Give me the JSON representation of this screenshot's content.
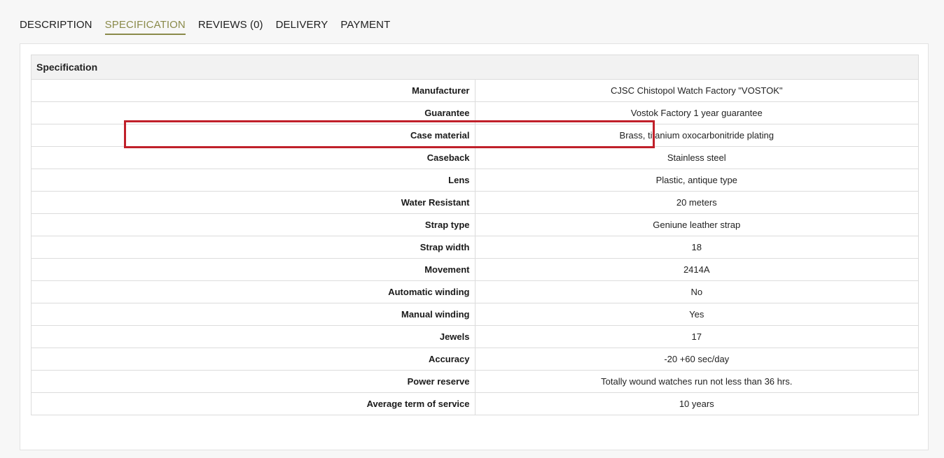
{
  "tabs": [
    {
      "label": "DESCRIPTION"
    },
    {
      "label": "SPECIFICATION"
    },
    {
      "label": "REVIEWS (0)"
    },
    {
      "label": "DELIVERY"
    },
    {
      "label": "PAYMENT"
    }
  ],
  "active_tab": "SPECIFICATION",
  "spec": {
    "heading": "Specification",
    "rows": [
      {
        "label": "Manufacturer",
        "value": "CJSC Chistopol Watch Factory \"VOSTOK\""
      },
      {
        "label": "Guarantee",
        "value": "Vostok Factory 1 year guarantee"
      },
      {
        "label": "Case material",
        "value": "Brass, titanium oxocarbonitride plating"
      },
      {
        "label": "Caseback",
        "value": "Stainless steel"
      },
      {
        "label": "Lens",
        "value": "Plastic, antique type"
      },
      {
        "label": "Water Resistant",
        "value": "20 meters"
      },
      {
        "label": "Strap type",
        "value": "Geniune leather strap"
      },
      {
        "label": "Strap width",
        "value": "18"
      },
      {
        "label": "Movement",
        "value": "2414A"
      },
      {
        "label": "Automatic winding",
        "value": "No"
      },
      {
        "label": "Manual winding",
        "value": "Yes"
      },
      {
        "label": "Jewels",
        "value": "17"
      },
      {
        "label": "Accuracy",
        "value": "-20 +60 sec/day"
      },
      {
        "label": "Power reserve",
        "value": "Totally wound watches run not less than 36 hrs."
      },
      {
        "label": "Average term of service",
        "value": "10 years"
      }
    ]
  },
  "colors": {
    "active_tab": "#8a8a4a",
    "highlight_box": "#c0202a"
  }
}
